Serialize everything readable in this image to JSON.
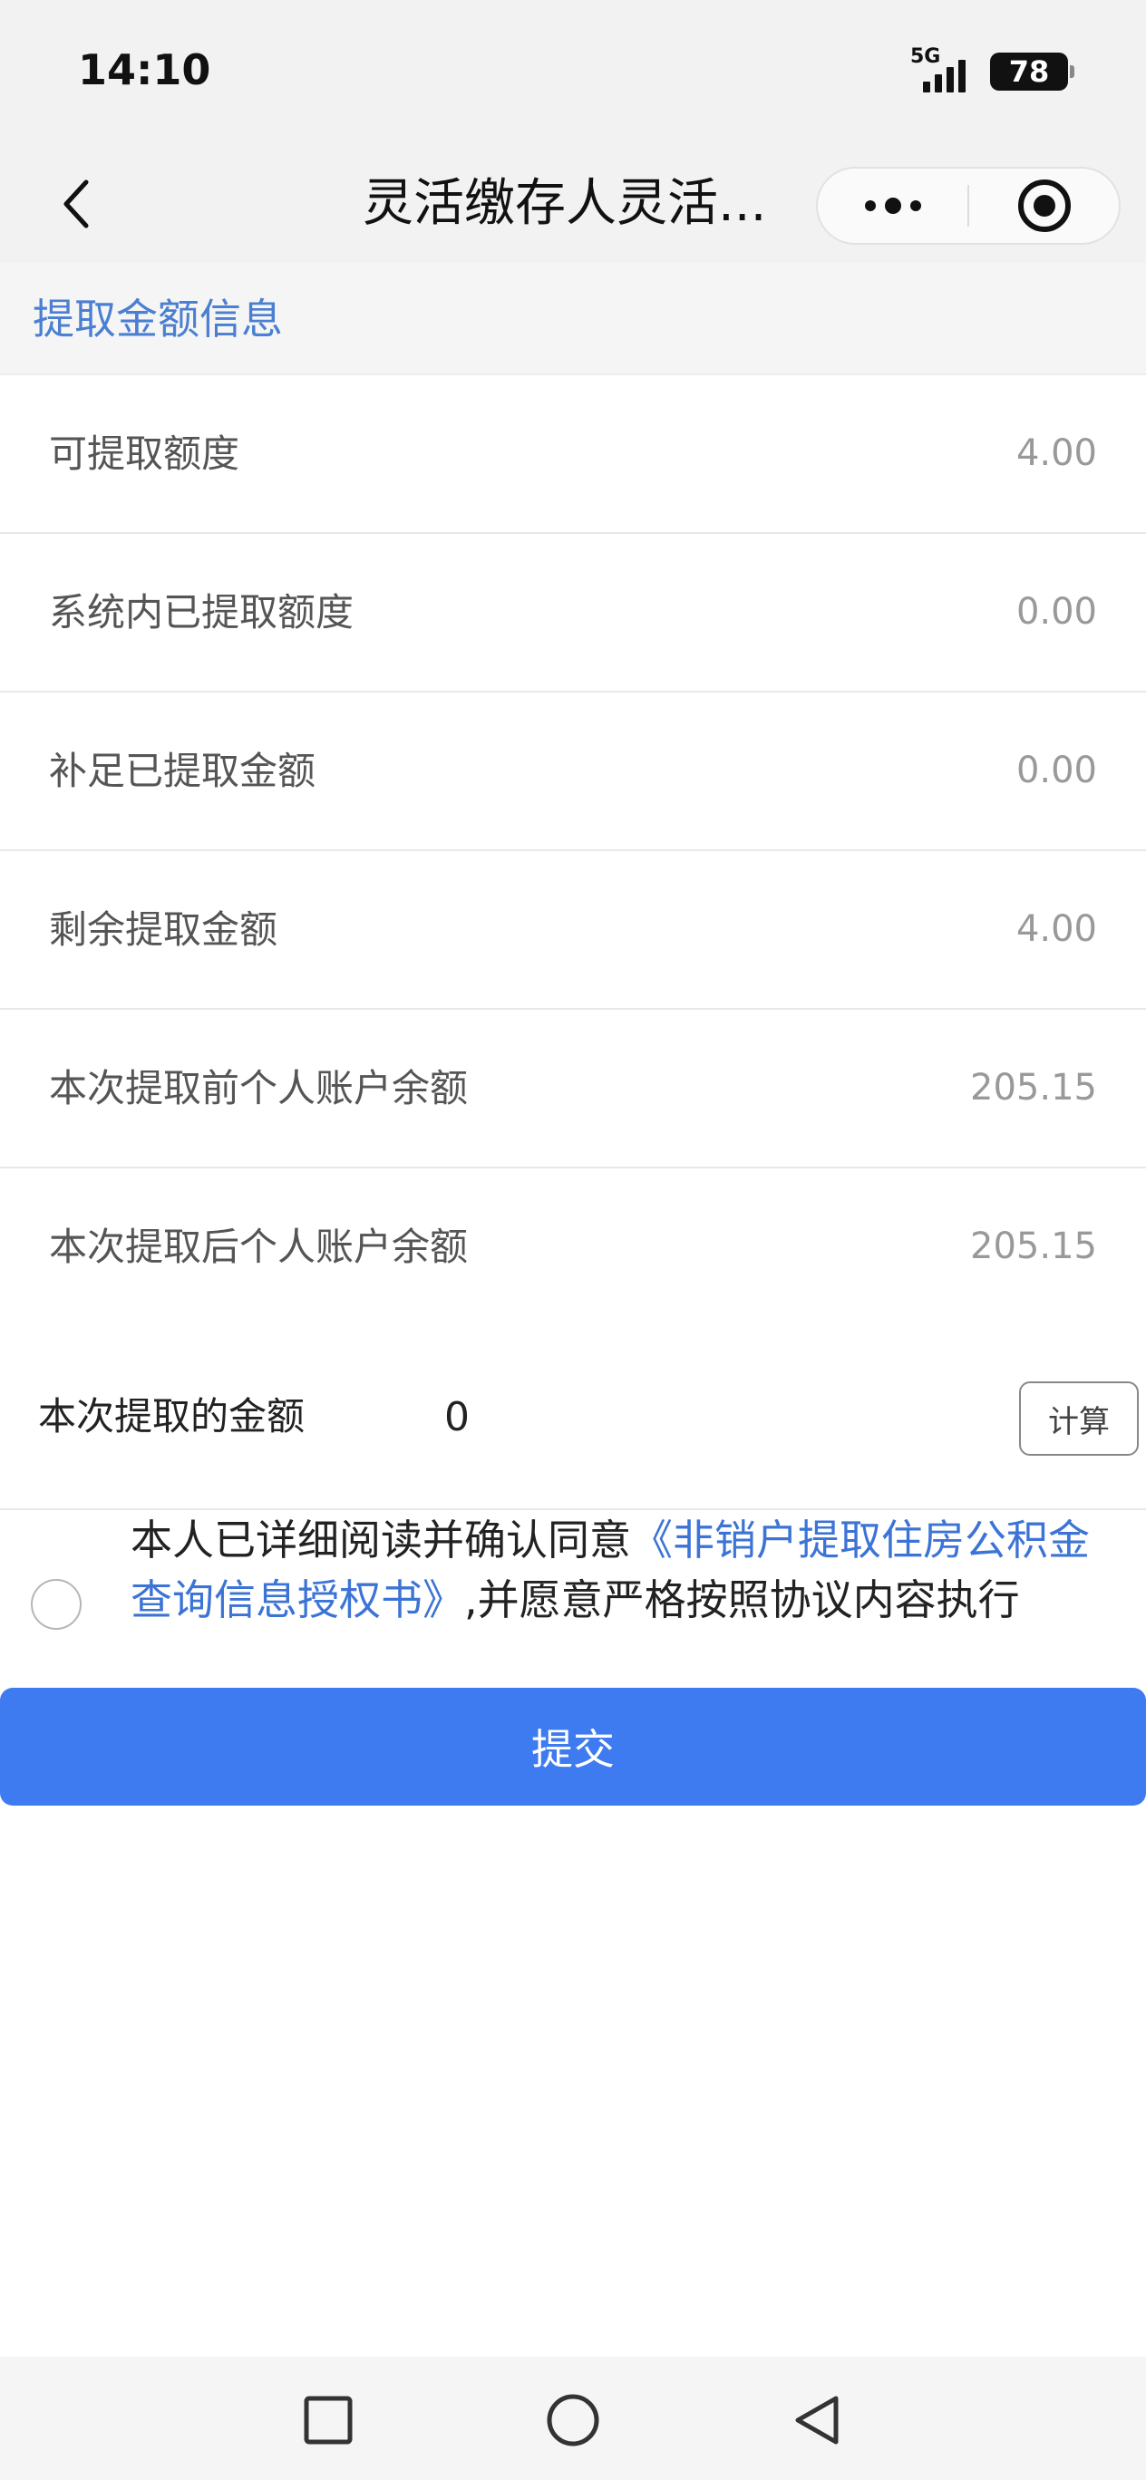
{
  "status_bar": {
    "time": "14:10",
    "network": "5G",
    "battery": "78"
  },
  "nav": {
    "title": "灵活缴存人灵活..."
  },
  "section": {
    "title": "提取金额信息"
  },
  "rows": [
    {
      "label": "可提取额度",
      "value": "4.00"
    },
    {
      "label": "系统内已提取额度",
      "value": "0.00"
    },
    {
      "label": "补足已提取金额",
      "value": "0.00"
    },
    {
      "label": "剩余提取金额",
      "value": "4.00"
    },
    {
      "label": "本次提取前个人账户余额",
      "value": "205.15"
    },
    {
      "label": "本次提取后个人账户余额",
      "value": "205.15"
    }
  ],
  "amount": {
    "label": "本次提取的金额",
    "value": "0",
    "calc_label": "计算"
  },
  "agreement": {
    "prefix": "本人已详细阅读并确认同意",
    "link": "《非销户提取住房公积金查询信息授权书》",
    "suffix": ",并愿意严格按照协议内容执行",
    "checked": false
  },
  "submit": {
    "label": "提交"
  },
  "icons": {
    "back": "chevron-left-icon",
    "more": "more-dots-icon",
    "target": "target-icon",
    "recents": "square-icon",
    "home": "circle-icon",
    "system_back": "triangle-back-icon"
  },
  "colors": {
    "accent": "#3e7bf0",
    "link": "#3c74d6",
    "section_title": "#4a7fd1"
  }
}
